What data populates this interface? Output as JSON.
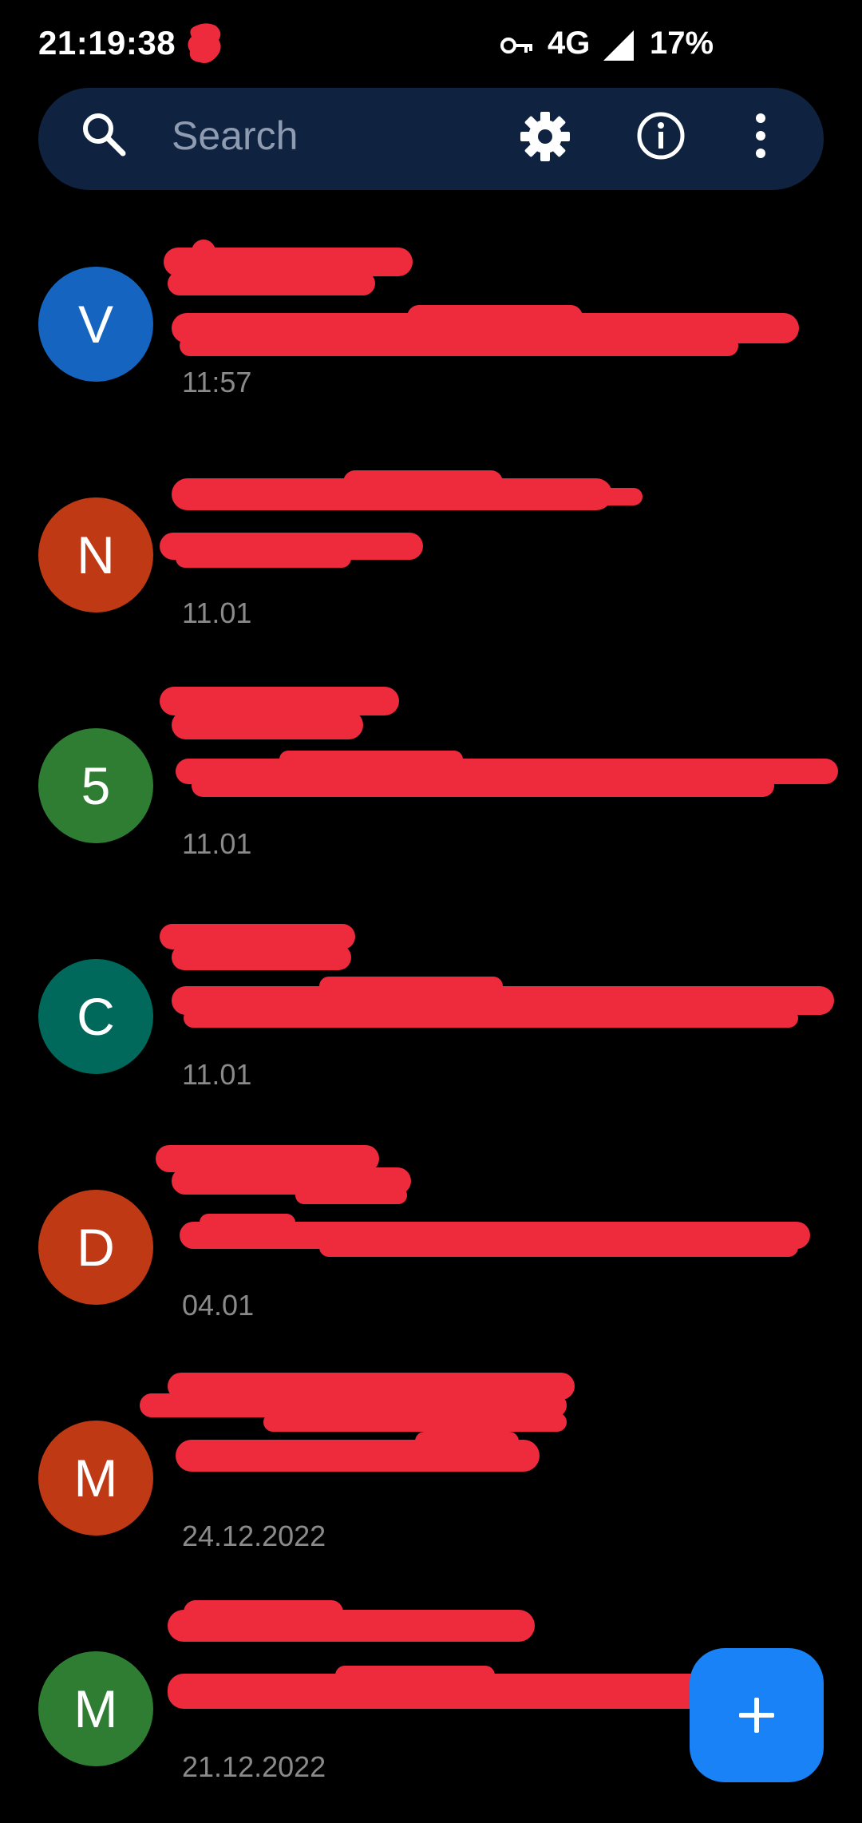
{
  "status_bar": {
    "time": "21:19:38",
    "network": "4G",
    "battery": "17%",
    "icons": [
      "notification-redacted-icon",
      "vpn-key-icon",
      "signal-icon"
    ]
  },
  "search": {
    "placeholder": "Search",
    "icons": [
      "search-icon",
      "gear-icon",
      "info-icon",
      "more-vert-icon"
    ]
  },
  "conversations": [
    {
      "initial": "V",
      "avatar_color": "#1565c0",
      "date": "11:57"
    },
    {
      "initial": "N",
      "avatar_color": "#bf3a14",
      "date": "11.01"
    },
    {
      "initial": "5",
      "avatar_color": "#2e7d32",
      "date": "11.01"
    },
    {
      "initial": "C",
      "avatar_color": "#00695c",
      "date": "11.01"
    },
    {
      "initial": "D",
      "avatar_color": "#bf3a14",
      "date": "04.01"
    },
    {
      "initial": "M",
      "avatar_color": "#bf3a14",
      "date": "24.12.2022"
    },
    {
      "initial": "M",
      "avatar_color": "#2e7d32",
      "date": "21.12.2022"
    }
  ],
  "fab": {
    "icon": "plus-icon",
    "color": "#1a82f7"
  },
  "redaction_color": "#ee2b3c"
}
